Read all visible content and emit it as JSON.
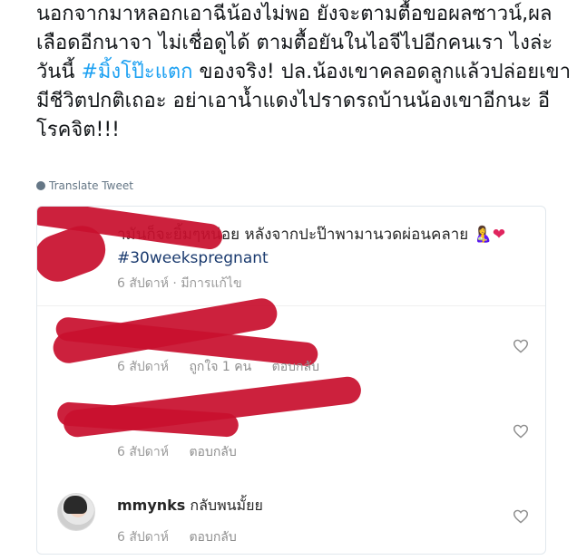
{
  "tweet": {
    "text_main": "นอกจากมาหลอกเอาฉีน้องไม่พอ ยังจะตามตื้อขอผลซาวน์,ผลเลือดอีกนาจา ไม่เชื่อดูได้ ตามตื้อยันในไอจีไปอีกคนเรา ไงล่ะวันนี้ ",
    "hashtag": "#มิ้งโป๊ะแตก",
    "text_after": " ของจริง! ปล.น้องเขาคลอดลูกแล้วปล่อยเขามีชีวิตปกติเถอะ อย่าเอาน้ำแดงไปราดรถบ้านน้องเขาอีกนะ อีโรคจิต!!!",
    "translate_label": "Translate Tweet"
  },
  "post": {
    "caption_text": "ามันก็จะยิ้มๆหน่อย หลังจากปะป๊าพามานวดผ่อนคลาย",
    "caption_emoji": "🤱❤",
    "caption_hashtag": "#30weekspregnant",
    "meta": "6 สัปดาห์ · มีการแก้ไข"
  },
  "comments": [
    {
      "time": "6 สัปดาห์",
      "likes": "ถูกใจ 1 คน",
      "reply": "ตอบกลับ"
    },
    {
      "time": "6 สัปดาห์",
      "reply": "ตอบกลับ"
    },
    {
      "username": "mmynks",
      "text": "กลับพนมั้ยย",
      "time": "6 สัปดาห์",
      "reply": "ตอบกลับ"
    }
  ],
  "colors": {
    "hashtag": "#1da1f2",
    "redaction": "#c8102e",
    "ig_tag": "#1b3b6f"
  }
}
